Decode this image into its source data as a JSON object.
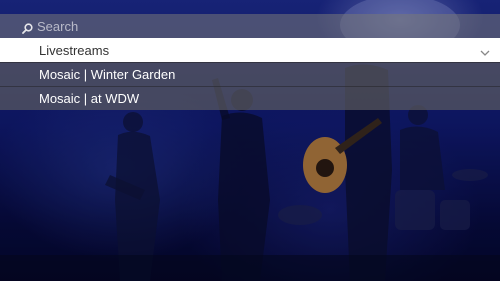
{
  "search": {
    "placeholder": "Search",
    "icon": "search-icon"
  },
  "menu": {
    "items": [
      {
        "label": "Livestreams",
        "selected": true,
        "icon": "chevron-down-icon"
      },
      {
        "label": "Mosaic | Winter Garden",
        "selected": false
      },
      {
        "label": "Mosaic | at WDW",
        "selected": false
      }
    ]
  },
  "colors": {
    "background": "#101a6c",
    "selected_row": "#ffffff",
    "row": "#5a5a5f"
  }
}
